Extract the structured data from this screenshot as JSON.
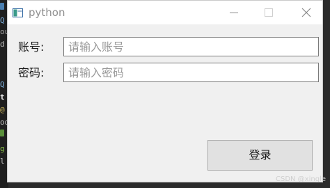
{
  "window": {
    "title": "python",
    "icon": "python-window-icon",
    "controls": [
      "minimize-icon",
      "maximize-icon",
      "close-icon"
    ]
  },
  "form": {
    "account_label": "账号:",
    "account_placeholder": "请输入账号",
    "account_value": "",
    "password_label": "密码:",
    "password_placeholder": "请输入密码",
    "password_value": ""
  },
  "actions": {
    "login_label": "登录"
  },
  "background_editor": {
    "fragments": [
      "Q",
      "ou",
      "d",
      "Q",
      "t",
      "@",
      "od",
      "g",
      "l"
    ]
  },
  "watermark": "CSDN @xingle",
  "colors": {
    "window_bg": "#f0f0f0",
    "titlebar_bg": "#ffffff",
    "button_bg": "#e1e1e1"
  }
}
